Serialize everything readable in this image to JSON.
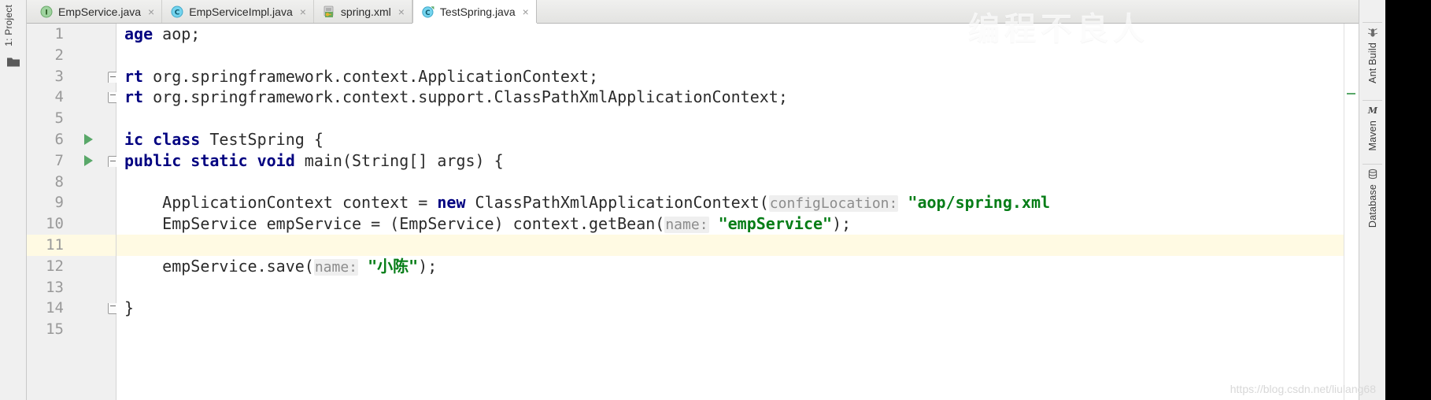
{
  "window": {
    "app": "IntelliJ IDEA",
    "watermark_top": "编程不良人",
    "watermark_bottom": "https://blog.csdn.net/liulang68"
  },
  "left_tool_strip": {
    "label": "1: Project",
    "icon": "folder-icon"
  },
  "right_tool_strip": {
    "items": [
      {
        "label": "Ant Build",
        "icon": "ant-icon"
      },
      {
        "label": "Maven",
        "icon": "maven-m-icon"
      },
      {
        "label": "Database",
        "icon": "database-icon"
      }
    ]
  },
  "tabs": [
    {
      "label": "EmpService.java",
      "icon": "java-interface-icon",
      "icon_letter": "I",
      "icon_color": "#77b877",
      "active": false,
      "close": "×"
    },
    {
      "label": "EmpServiceImpl.java",
      "icon": "java-class-icon",
      "icon_letter": "C",
      "icon_color": "#51c0e0",
      "active": false,
      "close": "×"
    },
    {
      "label": "spring.xml",
      "icon": "spring-config-icon",
      "icon_letter": "",
      "icon_color": "#69a85c",
      "active": false,
      "close": "×"
    },
    {
      "label": "TestSpring.java",
      "icon": "java-runnable-class-icon",
      "icon_letter": "C",
      "icon_color": "#51c0e0",
      "active": true,
      "close": "×"
    }
  ],
  "editor": {
    "caret_line": 11,
    "scrolled_horizontally": true,
    "lines": [
      {
        "num": "1",
        "run_marker": false,
        "fold": "",
        "highlight": false,
        "tokens": [
          {
            "t": "kw",
            "v": "age"
          },
          {
            "t": "plain",
            "v": " aop;"
          }
        ]
      },
      {
        "num": "2",
        "run_marker": false,
        "fold": "",
        "highlight": false,
        "tokens": []
      },
      {
        "num": "3",
        "run_marker": false,
        "fold": "top",
        "highlight": false,
        "tokens": [
          {
            "t": "kw",
            "v": "rt"
          },
          {
            "t": "plain",
            "v": " org.springframework.context.ApplicationContext;"
          }
        ]
      },
      {
        "num": "4",
        "run_marker": false,
        "fold": "bot",
        "highlight": false,
        "tokens": [
          {
            "t": "kw",
            "v": "rt"
          },
          {
            "t": "plain",
            "v": " org.springframework.context.support.ClassPathXmlApplicationContext;"
          }
        ]
      },
      {
        "num": "5",
        "run_marker": false,
        "fold": "",
        "highlight": false,
        "tokens": []
      },
      {
        "num": "6",
        "run_marker": true,
        "fold": "",
        "highlight": false,
        "tokens": [
          {
            "t": "kw",
            "v": "ic class"
          },
          {
            "t": "plain",
            "v": " TestSpring {"
          }
        ]
      },
      {
        "num": "7",
        "run_marker": true,
        "fold": "top",
        "highlight": false,
        "tokens": [
          {
            "t": "kw",
            "v": "public static void"
          },
          {
            "t": "plain",
            "v": " main(String[] args) {"
          }
        ]
      },
      {
        "num": "8",
        "run_marker": false,
        "fold": "",
        "highlight": false,
        "tokens": []
      },
      {
        "num": "9",
        "run_marker": false,
        "fold": "",
        "highlight": false,
        "tokens": [
          {
            "t": "plain",
            "v": "    ApplicationContext context = "
          },
          {
            "t": "kw",
            "v": "new"
          },
          {
            "t": "plain",
            "v": " ClassPathXmlApplicationContext("
          },
          {
            "t": "hint",
            "v": "configLocation:"
          },
          {
            "t": "plain",
            "v": " "
          },
          {
            "t": "str",
            "v": "\"aop/spring.xml"
          }
        ]
      },
      {
        "num": "10",
        "run_marker": false,
        "fold": "",
        "highlight": false,
        "tokens": [
          {
            "t": "plain",
            "v": "    EmpService empService = (EmpService) context.getBean("
          },
          {
            "t": "hint",
            "v": "name:"
          },
          {
            "t": "plain",
            "v": " "
          },
          {
            "t": "str",
            "v": "\"empService\""
          },
          {
            "t": "plain",
            "v": ");"
          }
        ]
      },
      {
        "num": "11",
        "run_marker": false,
        "fold": "",
        "highlight": true,
        "tokens": []
      },
      {
        "num": "12",
        "run_marker": false,
        "fold": "",
        "highlight": false,
        "tokens": [
          {
            "t": "plain",
            "v": "    empService.save("
          },
          {
            "t": "hint",
            "v": "name:"
          },
          {
            "t": "plain",
            "v": " "
          },
          {
            "t": "str",
            "v": "\"小陈\""
          },
          {
            "t": "plain",
            "v": ");"
          }
        ]
      },
      {
        "num": "13",
        "run_marker": false,
        "fold": "",
        "highlight": false,
        "tokens": []
      },
      {
        "num": "14",
        "run_marker": false,
        "fold": "bot",
        "highlight": false,
        "tokens": [
          {
            "t": "plain",
            "v": "}"
          }
        ]
      },
      {
        "num": "15",
        "run_marker": false,
        "fold": "",
        "highlight": false,
        "tokens": []
      }
    ]
  },
  "colors": {
    "keyword": "#000080",
    "string": "#067d17",
    "hint": "#8c8c8c",
    "caret_line_bg": "#fffae3",
    "gutter_bg": "#f0f0f0",
    "run_marker": "#59a869"
  }
}
